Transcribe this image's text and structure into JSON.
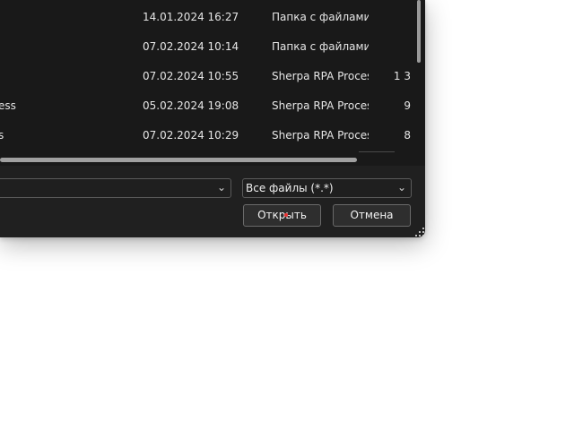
{
  "file_list": {
    "rows": [
      {
        "name": "",
        "date": "14.01.2024 16:27",
        "type": "Папка с файлами",
        "size": ""
      },
      {
        "name": "",
        "date": "07.02.2024 10:14",
        "type": "Папка с файлами",
        "size": ""
      },
      {
        "name": "",
        "date": "07.02.2024 10:55",
        "type": "Sherpa RPA Proces...",
        "size": "1 3"
      },
      {
        "name": "ess",
        "date": "05.02.2024 19:08",
        "type": "Sherpa RPA Proces...",
        "size": "9"
      },
      {
        "name": "s",
        "date": "07.02.2024 10:29",
        "type": "Sherpa RPA Proces...",
        "size": "8"
      }
    ]
  },
  "filename_field": {
    "value": ""
  },
  "filter": {
    "value": "Все файлы (*.*)"
  },
  "buttons": {
    "open": "Открыть",
    "cancel": "Отмена"
  },
  "icons": {
    "dropdown": "chevron-down-icon",
    "resize": "resize-grip-icon"
  },
  "colors": {
    "dialog_bg": "#202020",
    "list_bg": "#191919",
    "text": "#e6e6e6",
    "border": "#5a5a5a"
  }
}
